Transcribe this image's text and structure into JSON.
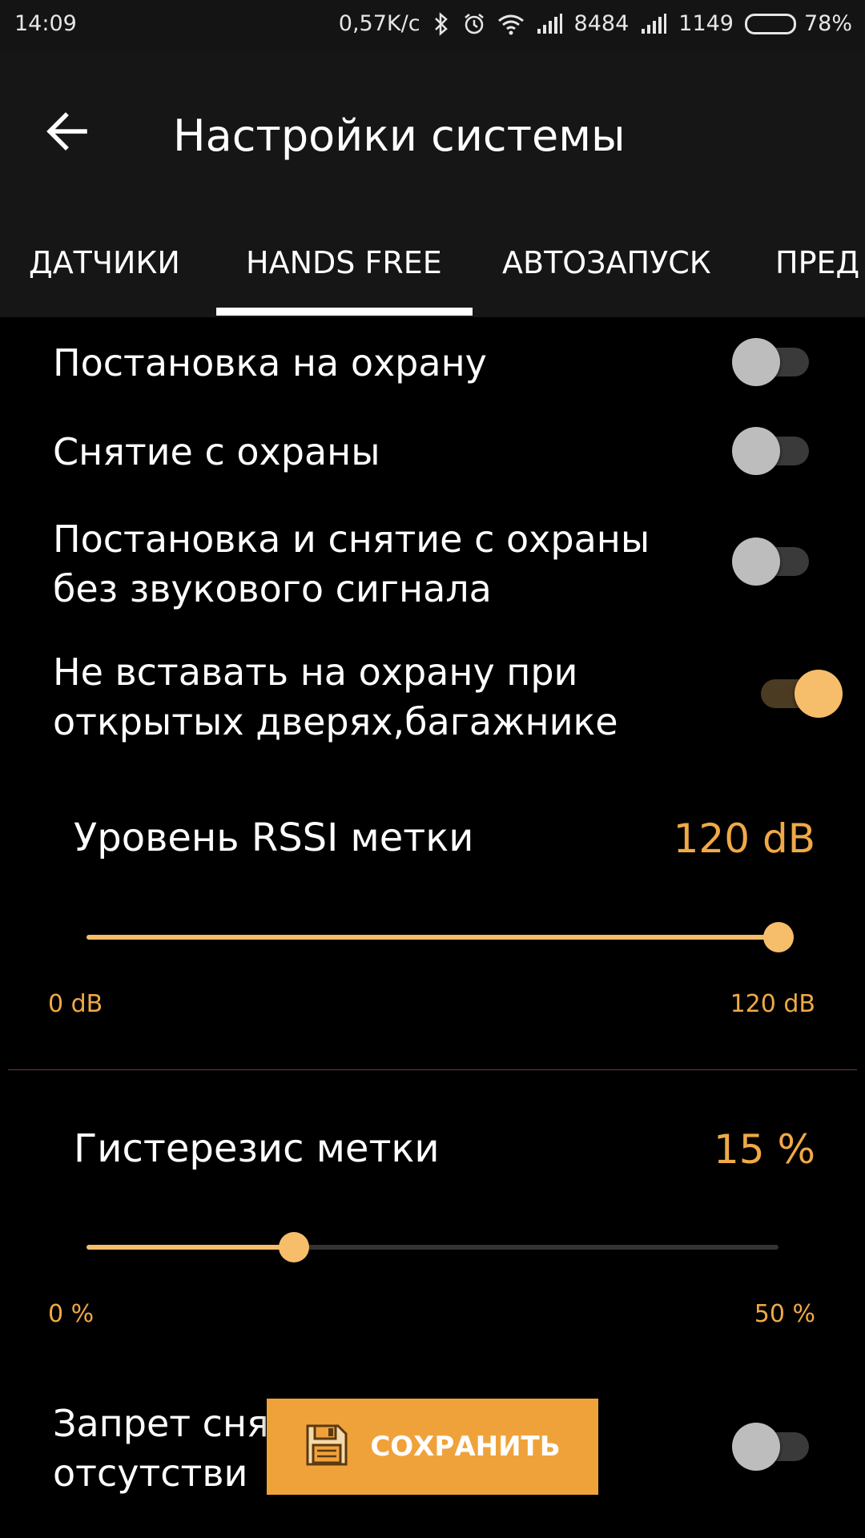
{
  "status_bar": {
    "time": "14:09",
    "speed": "0,57K/c",
    "sim1_value": "8484",
    "sim2_value": "1149",
    "battery": "78%",
    "battery_level": 0.78,
    "icons": [
      "bluetooth-icon",
      "alarm-icon",
      "wifi-icon",
      "signal-icon",
      "battery-icon"
    ]
  },
  "app_bar": {
    "title": "Настройки системы",
    "back_icon": "arrow-left-icon"
  },
  "tabs": [
    {
      "label": "ДАТЧИКИ",
      "selected": false
    },
    {
      "label": "HANDS FREE",
      "selected": true
    },
    {
      "label": "АВТОЗАПУСК",
      "selected": false
    },
    {
      "label": "ПРЕД",
      "selected": false
    }
  ],
  "settings": {
    "arm": {
      "label": "Постановка на охрану",
      "enabled": false
    },
    "disarm": {
      "label": "Снятие с охраны",
      "enabled": false
    },
    "silent": {
      "label": "Постановка и снятие с охраны без звукового сигнала",
      "enabled": false
    },
    "no_arm_doors": {
      "label": "Не вставать на охрану при открытых дверях,багажнике",
      "enabled": true
    },
    "disarm_ban": {
      "label": "Запрет снятия с охраны при отсутствии",
      "visible_label": "Запрет сня               и",
      "visible_label_line2": "отсутстви",
      "enabled": false
    }
  },
  "rssi": {
    "title": "Уровень RSSI метки",
    "value_text": "120 dB",
    "min_label": "0 dB",
    "max_label": "120 dB",
    "value": 120,
    "min": 0,
    "max": 120
  },
  "hysteresis": {
    "title": "Гистерезис метки",
    "value_text": "15  %",
    "min_label": "0  %",
    "max_label": "50  %",
    "value": 15,
    "min": 0,
    "max": 50
  },
  "save_button": {
    "label": "СОХРАНИТЬ",
    "icon": "floppy-disk-icon"
  },
  "colors": {
    "accent": "#f0a946",
    "accent_light": "#f6bd6a",
    "button": "#f0a23a",
    "background": "#000000",
    "bar": "#161616"
  }
}
